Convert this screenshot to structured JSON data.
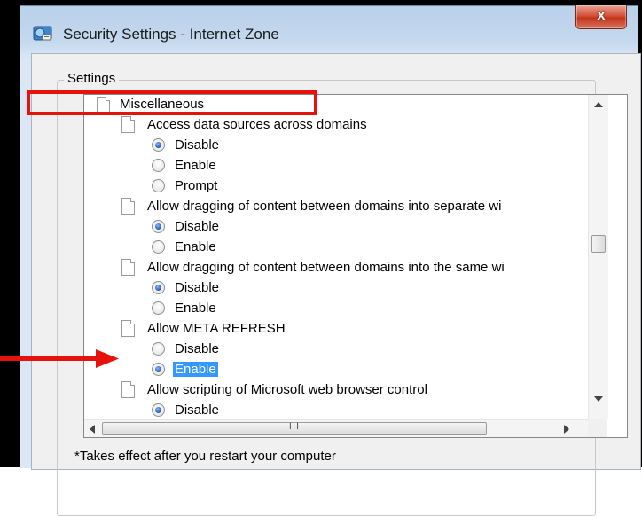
{
  "window": {
    "title": "Security Settings - Internet Zone",
    "close_label": "x"
  },
  "settings_group": {
    "legend": "Settings",
    "rows": [
      {
        "kind": "category",
        "label": "Miscellaneous"
      },
      {
        "kind": "setting",
        "label": "Access data sources across domains"
      },
      {
        "kind": "option",
        "label": "Disable",
        "checked": true
      },
      {
        "kind": "option",
        "label": "Enable",
        "checked": false
      },
      {
        "kind": "option",
        "label": "Prompt",
        "checked": false
      },
      {
        "kind": "setting",
        "label": "Allow dragging of content between domains into separate wi"
      },
      {
        "kind": "option",
        "label": "Disable",
        "checked": true
      },
      {
        "kind": "option",
        "label": "Enable",
        "checked": false
      },
      {
        "kind": "setting",
        "label": "Allow dragging of content between domains into the same wi"
      },
      {
        "kind": "option",
        "label": "Disable",
        "checked": true
      },
      {
        "kind": "option",
        "label": "Enable",
        "checked": false
      },
      {
        "kind": "setting",
        "label": "Allow META REFRESH"
      },
      {
        "kind": "option",
        "label": "Disable",
        "checked": false
      },
      {
        "kind": "option",
        "label": "Enable",
        "checked": true,
        "selected": true
      },
      {
        "kind": "setting",
        "label": "Allow scripting of Microsoft web browser control"
      },
      {
        "kind": "option",
        "label": "Disable",
        "checked": true
      }
    ],
    "hscroll_grip": "III"
  },
  "footnote": "*Takes effect after you restart your computer",
  "colors": {
    "selection": "#3399ff",
    "annotation_red": "#e8120c",
    "radio_dot": "#2a67c7"
  }
}
